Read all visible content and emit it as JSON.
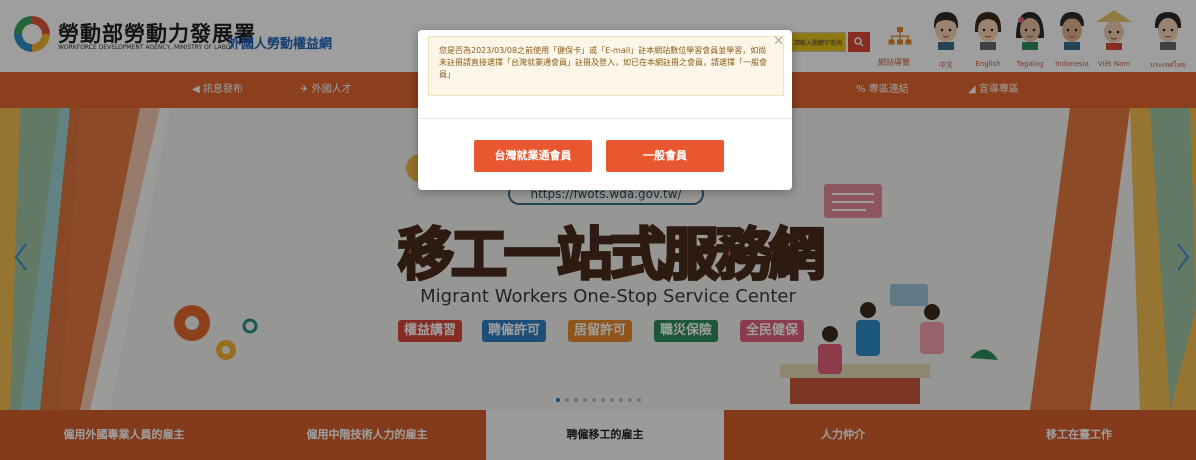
{
  "header": {
    "agency_name": "勞動部勞動力發展署",
    "agency_english": "WORKFORCE DEVELOPMENT AGENCY, MINISTRY OF LABOR",
    "site_title": "外國人勞動權益網",
    "search": {
      "value": "請輸入關鍵字查詢",
      "button_icon": "search-icon"
    },
    "sitemap_label": "網站導覽",
    "languages": [
      "中文",
      "English",
      "Tagalog",
      "Indonesia",
      "Việt Nam",
      "ประเทศไทย"
    ]
  },
  "nav": {
    "items": [
      "訊息發布",
      "外國人才",
      "",
      "",
      "",
      "專區連結",
      "宣導專區"
    ]
  },
  "hero": {
    "url": "https://fwots.wda.gov.tw/",
    "title": "移工一站式服務網",
    "subtitle": "Migrant Workers One-Stop Service Center",
    "tags": [
      {
        "label": "權益講習",
        "color": "#d9443a"
      },
      {
        "label": "聘僱許可",
        "color": "#2f7fc1"
      },
      {
        "label": "居留許可",
        "color": "#e8892a"
      },
      {
        "label": "職災保險",
        "color": "#2e8f5a"
      },
      {
        "label": "全民健保",
        "color": "#e2607a"
      }
    ],
    "dots": 10,
    "active_dot": 0
  },
  "tabs": [
    {
      "label": "僱用外國專業人員的雇主",
      "active": false
    },
    {
      "label": "僱用中階技術人力的雇主",
      "active": false
    },
    {
      "label": "聘僱移工的雇主",
      "active": true
    },
    {
      "label": "人力仲介",
      "active": false
    },
    {
      "label": "移工在臺工作",
      "active": false
    }
  ],
  "modal": {
    "notice": "您是否為2023/03/08之前使用「健保卡」或「E-mail」註本網站數位學習會員並學習，如尚未註冊請直接選擇「台灣就業通會員」註冊及登入，如已在本網註冊之會員，請選擇「一般會員」",
    "close_icon": "close-icon",
    "button_primary": "台灣就業通會員",
    "button_secondary": "一般會員"
  },
  "colors": {
    "brand_orange": "#e1662f",
    "tab_orange": "#d4602c",
    "modal_button": "#e8572f",
    "site_title_blue": "#2565b7"
  }
}
